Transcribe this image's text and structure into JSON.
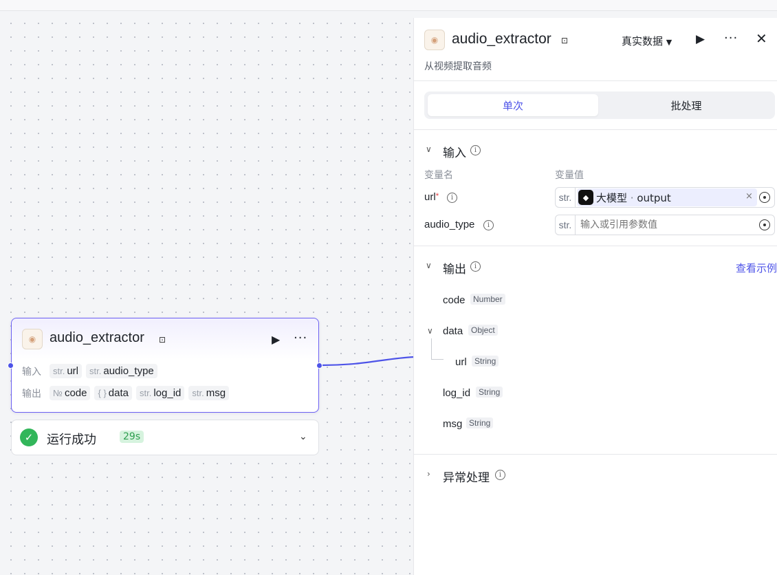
{
  "node": {
    "title": "audio_extractor",
    "input_label": "输入",
    "output_label": "输出",
    "inputs": [
      {
        "type": "str.",
        "name": "url"
      },
      {
        "type": "str.",
        "name": "audio_type"
      }
    ],
    "outputs": [
      {
        "type": "№",
        "name": "code"
      },
      {
        "type": "{ }",
        "name": "data"
      },
      {
        "type": "str.",
        "name": "log_id"
      },
      {
        "type": "str.",
        "name": "msg"
      }
    ]
  },
  "status": {
    "text": "运行成功",
    "time": "29s"
  },
  "panel": {
    "title": "audio_extractor",
    "description": "从视频提取音频",
    "data_select": "真实数据",
    "tabs": [
      {
        "label": "单次",
        "active": true
      },
      {
        "label": "批处理",
        "active": false
      }
    ],
    "input_section": {
      "title": "输入",
      "col_name": "变量名",
      "col_value": "变量值",
      "vars": [
        {
          "name": "url",
          "required": true,
          "type": "str.",
          "ref_node": "大模型",
          "ref_sep": " · ",
          "ref_field": "output"
        },
        {
          "name": "audio_type",
          "required": false,
          "type": "str.",
          "placeholder": "输入或引用参数值"
        }
      ]
    },
    "output_section": {
      "title": "输出",
      "view_example": "查看示例",
      "fields": [
        {
          "name": "code",
          "type": "Number"
        },
        {
          "name": "data",
          "type": "Object"
        },
        {
          "name": "url",
          "type": "String"
        },
        {
          "name": "log_id",
          "type": "String"
        },
        {
          "name": "msg",
          "type": "String"
        }
      ]
    },
    "error_section": {
      "title": "异常处理"
    }
  },
  "colors": {
    "accent": "#4d53e8",
    "success": "#32b65a"
  }
}
